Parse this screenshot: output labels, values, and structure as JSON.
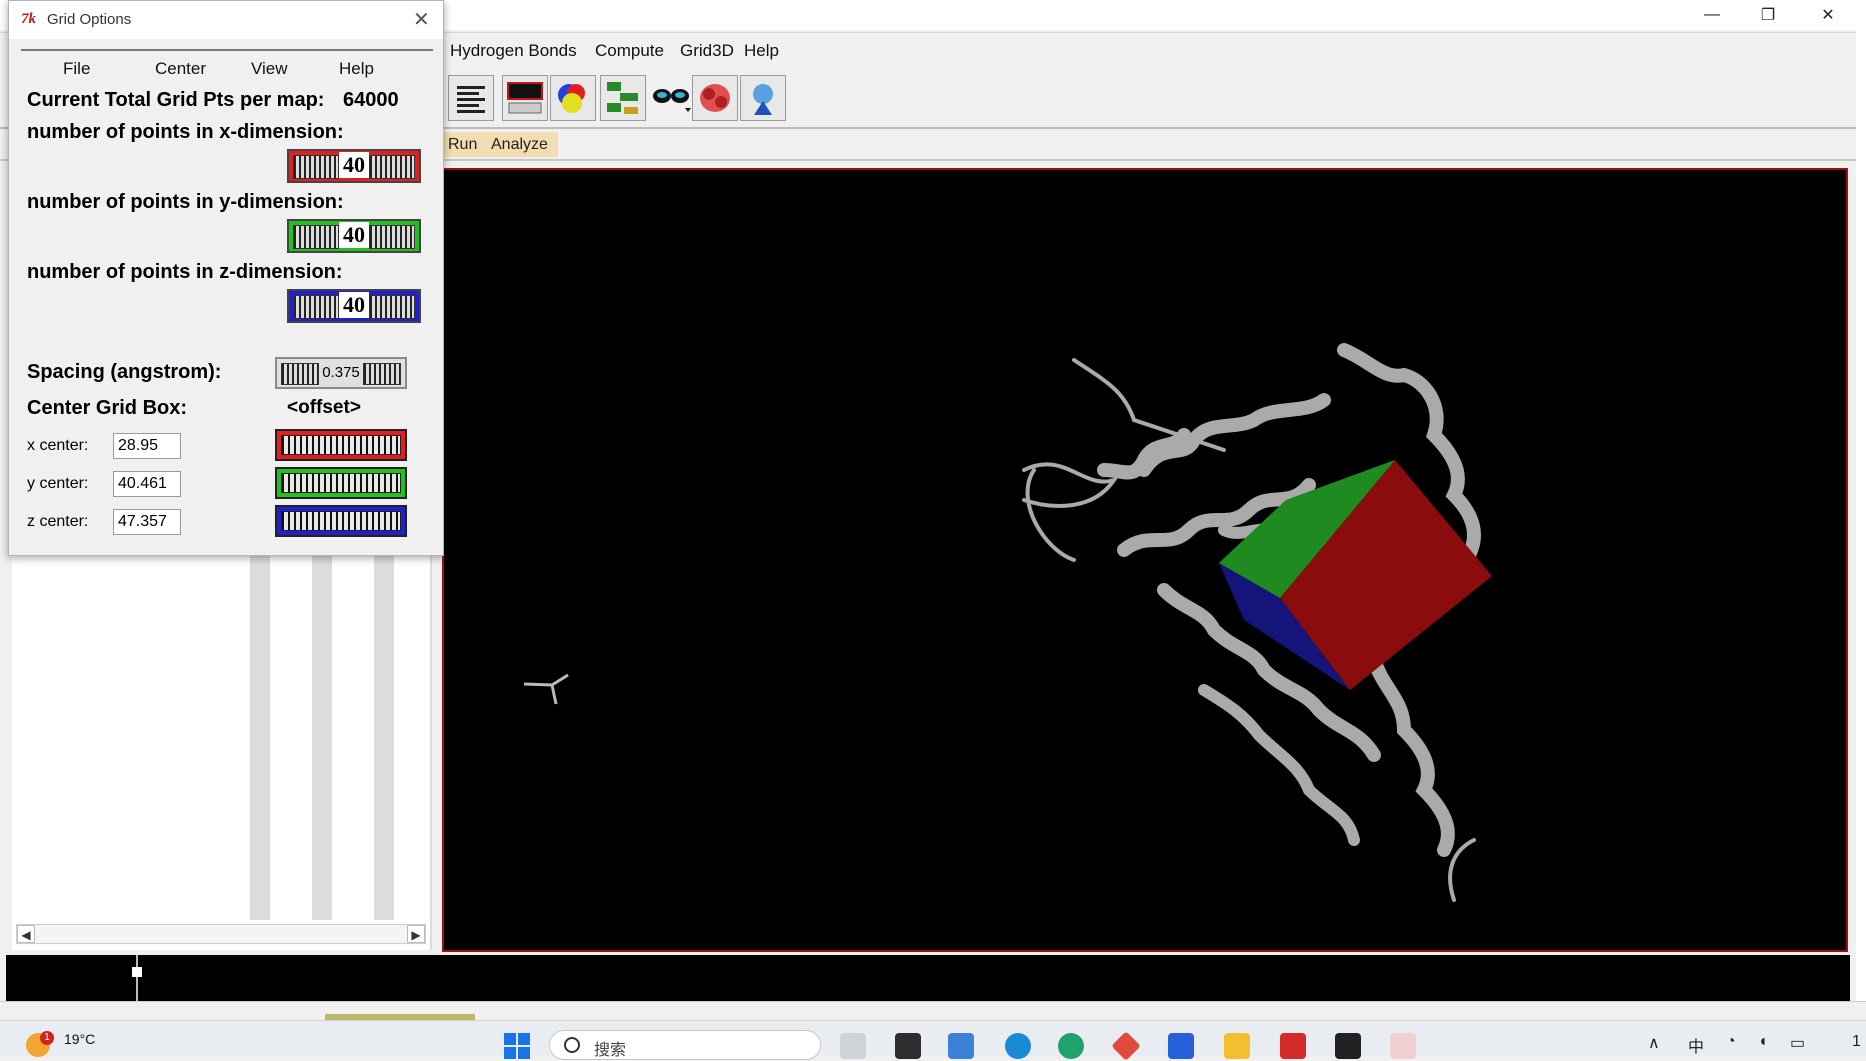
{
  "main_window": {
    "menu": [
      "Hydrogen Bonds",
      "Compute",
      "Grid3D",
      "Help"
    ],
    "tabs": [
      "Run",
      "Analyze"
    ],
    "controls": {
      "minimize": "—",
      "maximize": "❐",
      "close": "✕"
    }
  },
  "toolbar_icons": [
    "text-align-icon",
    "monitor-icon",
    "color-balls-icon",
    "hierarchy-icon",
    "3d-glasses-icon",
    "molecule-surface-icon",
    "pmv-icon"
  ],
  "dialog": {
    "title": "Grid Options",
    "logo": "7k",
    "close": "✕",
    "menu": [
      "File",
      "Center",
      "View",
      "Help"
    ],
    "total_label": "Current Total Grid Pts per map:",
    "total_value": "64000",
    "x_dim_label": "number of points in x-dimension:",
    "x_dim_value": "40",
    "y_dim_label": "number of points in y-dimension:",
    "y_dim_value": "40",
    "z_dim_label": "number of points in z-dimension:",
    "z_dim_value": "40",
    "spacing_label": "Spacing (angstrom):",
    "spacing_value": "0.375",
    "center_label": "Center Grid Box:",
    "offset_label": "<offset>",
    "x_center_label": "x center:",
    "x_center_value": "28.95",
    "y_center_label": "y center:",
    "y_center_value": "40.461",
    "z_center_label": "z center:",
    "z_center_value": "47.357"
  },
  "colors": {
    "x": "#e02020",
    "y": "#20c020",
    "z": "#2020d0",
    "viewer_border": "#a01010"
  },
  "taskbar": {
    "badge": "1",
    "temperature": "19°C",
    "search_placeholder": "搜索",
    "tray_ime": "中",
    "tray_partial": "1"
  }
}
